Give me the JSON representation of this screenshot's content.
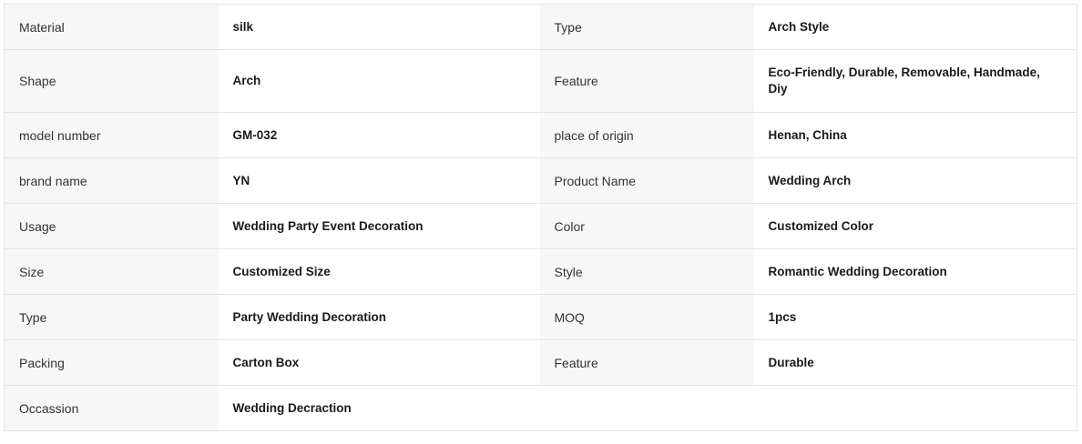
{
  "specs": {
    "rows": [
      {
        "l1": "Material",
        "v1": "silk",
        "l2": "Type",
        "v2": "Arch Style"
      },
      {
        "l1": "Shape",
        "v1": "Arch",
        "l2": "Feature",
        "v2": "Eco-Friendly, Durable, Removable, Handmade, Diy"
      },
      {
        "l1": "model number",
        "v1": "GM-032",
        "l2": "place of origin",
        "v2": "Henan, China"
      },
      {
        "l1": "brand name",
        "v1": "YN",
        "l2": "Product Name",
        "v2": "Wedding Arch"
      },
      {
        "l1": "Usage",
        "v1": "Wedding Party Event Decoration",
        "l2": "Color",
        "v2": "Customized Color"
      },
      {
        "l1": "Size",
        "v1": "Customized Size",
        "l2": "Style",
        "v2": "Romantic Wedding Decoration"
      },
      {
        "l1": "Type",
        "v1": "Party Wedding Decoration",
        "l2": "MOQ",
        "v2": "1pcs"
      },
      {
        "l1": "Packing",
        "v1": "Carton Box",
        "l2": "Feature",
        "v2": "Durable"
      },
      {
        "l1": "Occassion",
        "v1": "Wedding Decraction"
      }
    ]
  },
  "colors": {
    "label_background": "#f7f7f7",
    "value_background": "#ffffff",
    "border": "#e3e3e3"
  }
}
